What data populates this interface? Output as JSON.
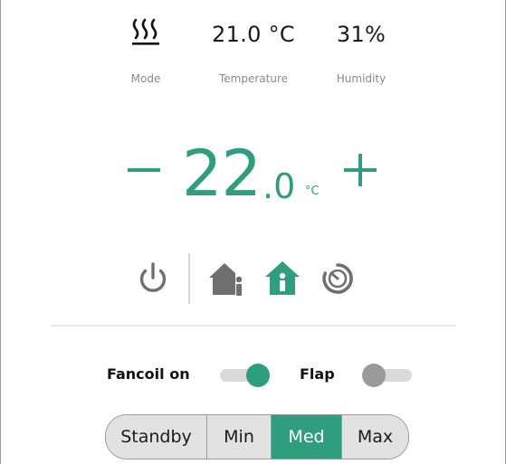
{
  "status": {
    "mode": {
      "icon": "heating-icon",
      "label": "Mode"
    },
    "temperature": {
      "value": "21.0 °C",
      "label": "Temperature"
    },
    "humidity": {
      "value": "31%",
      "label": "Humidity"
    }
  },
  "setpoint": {
    "integer": "22",
    "decimal": ".0",
    "unit": "°C",
    "minus_icon": "minus-icon",
    "plus_icon": "plus-icon"
  },
  "modes": {
    "icons": [
      "power-icon",
      "away-icon",
      "home-icon",
      "timer-icon"
    ],
    "active": "home-icon"
  },
  "toggles": {
    "fancoil": {
      "label": "Fancoil on",
      "on": true
    },
    "flap": {
      "label": "Flap",
      "on": false
    }
  },
  "fan_speed": {
    "options": [
      "Standby",
      "Min",
      "Med",
      "Max"
    ],
    "selected": "Med"
  },
  "colors": {
    "accent": "#2f9e80",
    "inactive_icon": "#6f6f6f",
    "track": "#dadada",
    "segment_bg": "#e2e2e2"
  }
}
